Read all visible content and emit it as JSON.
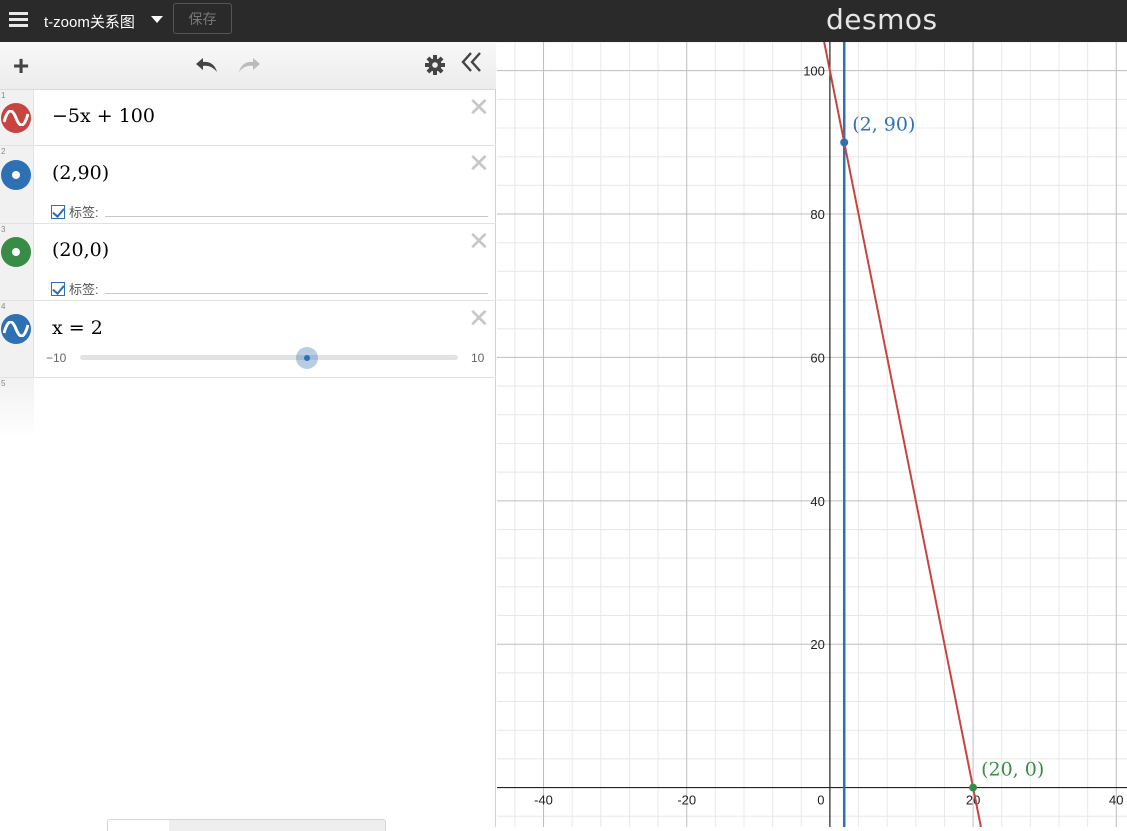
{
  "topbar": {
    "title": "t-zoom关系图",
    "save_label": "保存",
    "brand": "desmos",
    "menu_icon": "hamburger-icon"
  },
  "toolbar": {
    "add_icon": "plus-icon",
    "undo_icon": "undo-icon",
    "redo_icon": "redo-icon",
    "settings_icon": "gear-icon",
    "collapse_icon": "double-chevron-left-icon"
  },
  "expressions": [
    {
      "index": "1",
      "kind": "curve",
      "color": "#c74440",
      "latex": "−5x + 100"
    },
    {
      "index": "2",
      "kind": "point",
      "color": "#2d70b3",
      "latex": "(2,90)",
      "label_text": "标签:",
      "label_checked": true
    },
    {
      "index": "3",
      "kind": "point",
      "color": "#388c46",
      "latex": "(20,0)",
      "label_text": "标签:",
      "label_checked": true
    },
    {
      "index": "4",
      "kind": "curve",
      "color": "#2d70b3",
      "latex": "x = 2",
      "slider": {
        "min": "−10",
        "max": "10",
        "value": 2
      }
    },
    {
      "index": "5",
      "kind": "empty"
    }
  ],
  "graph": {
    "x_ticks": [
      "-40",
      "-20",
      "0",
      "20",
      "40"
    ],
    "y_ticks": [
      "20",
      "40",
      "60",
      "80",
      "100"
    ],
    "xlim": [
      -46.5,
      41.5
    ],
    "ylim": [
      -5.5,
      104
    ],
    "grid": true,
    "line_color": "#c74440",
    "vline_color": "#2d70b3",
    "point_labels": [
      {
        "text": "(2, 90)",
        "x": 2,
        "y": 90,
        "color": "#2d70b3"
      },
      {
        "text": "(20, 0)",
        "x": 20,
        "y": 0,
        "color": "#388c46"
      }
    ]
  }
}
